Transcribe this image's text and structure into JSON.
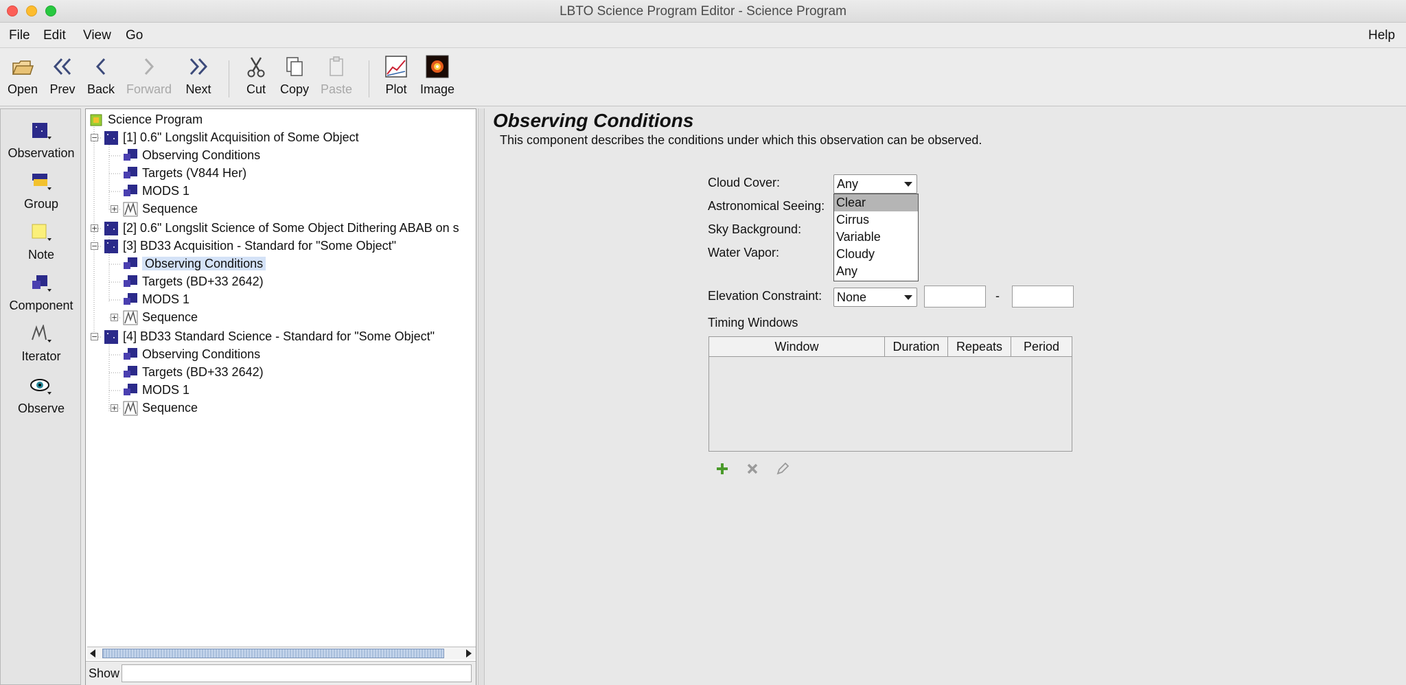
{
  "window": {
    "title": "LBTO Science Program Editor - Science Program",
    "traffic_lights": {
      "close": "#fc5f57",
      "minimize": "#fdbc2e",
      "maximize": "#28c840"
    }
  },
  "menu": {
    "file": "File",
    "edit": "Edit",
    "view": "View",
    "go": "Go",
    "help": "Help"
  },
  "toolbar": {
    "open": "Open",
    "prev": "Prev",
    "back": "Back",
    "forward": "Forward",
    "next": "Next",
    "cut": "Cut",
    "copy": "Copy",
    "paste": "Paste",
    "plot": "Plot",
    "image": "Image"
  },
  "palette": {
    "observation": "Observation",
    "group": "Group",
    "note": "Note",
    "component": "Component",
    "iterator": "Iterator",
    "observe": "Observe"
  },
  "tree": {
    "root": "Science Program",
    "obs1": {
      "label": "[1] 0.6\" Longslit Acquisition of Some Object",
      "conditions": "Observing Conditions",
      "targets": "Targets (V844 Her)",
      "instrument": "MODS 1",
      "sequence": "Sequence"
    },
    "obs2": {
      "label": "[2] 0.6\" Longslit Science of Some Object Dithering ABAB on s"
    },
    "obs3": {
      "label": "[3] BD33 Acquisition - Standard for \"Some Object\"",
      "conditions": "Observing Conditions",
      "targets": "Targets (BD+33 2642)",
      "instrument": "MODS 1",
      "sequence": "Sequence"
    },
    "obs4": {
      "label": "[4] BD33 Standard Science - Standard for \"Some Object\"",
      "conditions": "Observing Conditions",
      "targets": "Targets (BD+33 2642)",
      "instrument": "MODS 1",
      "sequence": "Sequence"
    },
    "show_label": "Show",
    "show_value": ""
  },
  "editor": {
    "title": "Observing Conditions",
    "description": "This component describes the conditions under which this observation can be observed.",
    "cloud_cover_label": "Cloud Cover:",
    "cloud_cover_value": "Any",
    "cloud_cover_options": [
      "Clear",
      "Cirrus",
      "Variable",
      "Cloudy",
      "Any"
    ],
    "seeing_label": "Astronomical Seeing:",
    "sky_label": "Sky Background:",
    "water_label": "Water Vapor:",
    "elevation_label": "Elevation Constraint:",
    "elevation_value": "None",
    "elevation_min": "",
    "elevation_max": "",
    "elevation_dash": "-",
    "timing_label": "Timing Windows",
    "timing_columns": [
      "Window",
      "Duration",
      "Repeats",
      "Period"
    ]
  },
  "icons": {
    "add": "plus-icon",
    "remove": "remove-icon",
    "edit": "edit-icon"
  },
  "colors": {
    "selection": "#d4e2f7",
    "observation_icon": "#2b2a8a",
    "add_icon": "#4a9a2a"
  }
}
